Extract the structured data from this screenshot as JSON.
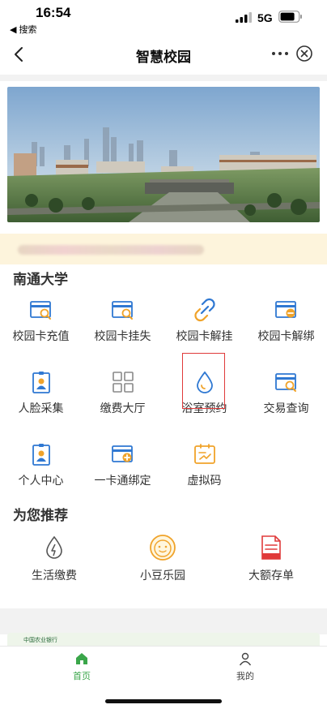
{
  "status_bar": {
    "time": "16:54",
    "back_label": "◀ 搜索",
    "network": "5G"
  },
  "nav": {
    "title": "智慧校园"
  },
  "section_university": {
    "title": "南通大学",
    "items": [
      {
        "label": "校园卡充值",
        "icon": "card-search-icon"
      },
      {
        "label": "校园卡挂失",
        "icon": "card-search-icon"
      },
      {
        "label": "校园卡解挂",
        "icon": "unlink-icon"
      },
      {
        "label": "校园卡解绑",
        "icon": "card-minus-icon"
      },
      {
        "label": "人脸采集",
        "icon": "badge-person-icon"
      },
      {
        "label": "缴费大厅",
        "icon": "grid-icon"
      },
      {
        "label": "浴室预约",
        "icon": "water-drop-icon"
      },
      {
        "label": "交易查询",
        "icon": "card-search-icon"
      },
      {
        "label": "个人中心",
        "icon": "badge-person-icon"
      },
      {
        "label": "一卡通绑定",
        "icon": "card-add-icon"
      },
      {
        "label": "虚拟码",
        "icon": "virtual-code-icon"
      }
    ]
  },
  "section_recommend": {
    "title": "为您推荐",
    "items": [
      {
        "label": "生活缴费",
        "icon": "utility-drop-icon"
      },
      {
        "label": "小豆乐园",
        "icon": "bean-face-icon"
      },
      {
        "label": "大额存单",
        "icon": "certificate-icon"
      }
    ]
  },
  "ad": {
    "text": "中国农业银行"
  },
  "tabbar": {
    "items": [
      {
        "label": "首页",
        "icon": "home-icon",
        "active": true
      },
      {
        "label": "我的",
        "icon": "person-icon",
        "active": false
      }
    ]
  },
  "colors": {
    "primary_blue": "#2f78d2",
    "accent_orange": "#f0a32a",
    "active_green": "#3aa64a",
    "highlight_red": "#e03a3a"
  }
}
